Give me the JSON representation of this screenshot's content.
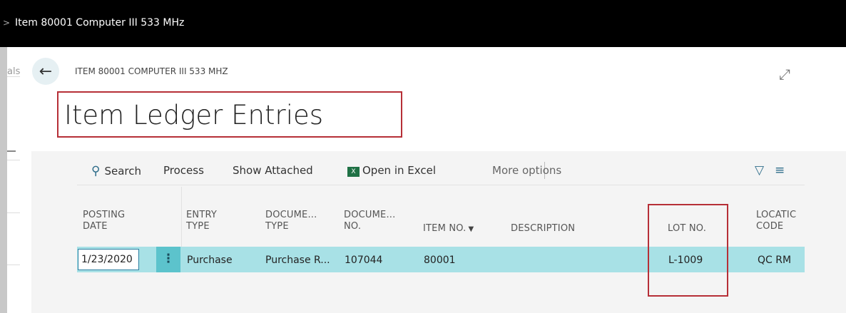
{
  "top_bar": {
    "chevron": ">",
    "title": "Item 80001 Computer III 533 MHz"
  },
  "left_ghost": {
    "partial_text": "als"
  },
  "header": {
    "back_icon": "←",
    "breadcrumb": "ITEM 80001 COMPUTER III 533 MHZ",
    "expand_icon": "⤢",
    "page_title": "Item Ledger Entries"
  },
  "actions": {
    "search_icon": "⚲",
    "search": "Search",
    "process": "Process",
    "show_attached": "Show Attached",
    "excel_icon": "X",
    "open_in_excel": "Open in Excel",
    "more_options": "More options",
    "filter_icon": "▽",
    "list_icon": "≡"
  },
  "table": {
    "headers": {
      "posting_date": [
        "POSTING",
        "DATE"
      ],
      "entry_type": [
        "ENTRY",
        "TYPE"
      ],
      "document_type": [
        "DOCUME...",
        "TYPE"
      ],
      "document_no": [
        "DOCUME...",
        "NO."
      ],
      "item_no": "ITEM NO.",
      "item_no_filter_icon": "▼",
      "description": "DESCRIPTION",
      "lot_no": "LOT NO.",
      "location_code": [
        "LOCATIC",
        "CODE"
      ]
    },
    "rows": [
      {
        "posting_date": "1/23/2020",
        "menu_icon": "⋮",
        "entry_type": "Purchase",
        "document_type": "Purchase R...",
        "document_no": "107044",
        "item_no": "80001",
        "description": "",
        "lot_no": "L-1009",
        "location_code": "QC RM"
      }
    ]
  },
  "colors": {
    "top_bar": "#000000",
    "selected_row": "#a8e1e6",
    "row_menu": "#5cc3cc",
    "highlight_box": "#b62f37",
    "accent": "#2e6d8a",
    "excel": "#1f7145"
  }
}
